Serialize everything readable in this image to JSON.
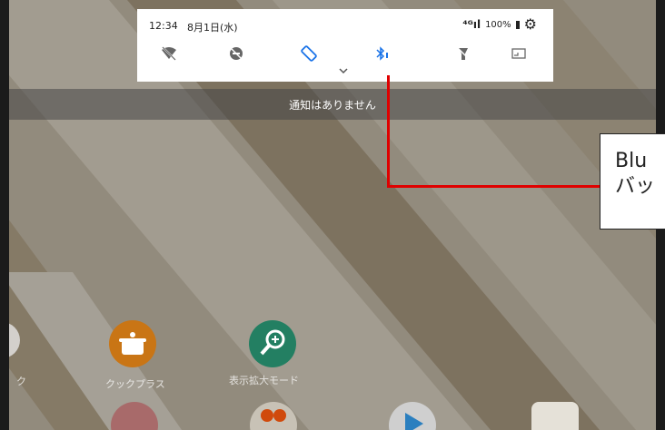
{
  "status_bar": {
    "time": "12:34",
    "date": "8月1日(水)",
    "signal_label": "⁴ᴳıl",
    "battery": "100%"
  },
  "quick_settings": {
    "tiles": [
      "wifi-off-icon",
      "do-not-disturb-off-icon",
      "auto-rotate-icon",
      "bluetooth-icon",
      "flashlight-off-icon",
      "cast-icon"
    ]
  },
  "notifications": {
    "empty_text": "通知はありません"
  },
  "callout": {
    "line1": "Blu",
    "line2": "バッ"
  },
  "home_apps": [
    {
      "label": "ク"
    },
    {
      "label": "クックプラス"
    },
    {
      "label": "表示拡大モード"
    }
  ],
  "colors": {
    "callout_red": "#e00000",
    "bluetooth_blue": "#1a73e8",
    "cookplus_orange": "#e88a1a",
    "magnifier_teal": "#2a9d7a"
  }
}
